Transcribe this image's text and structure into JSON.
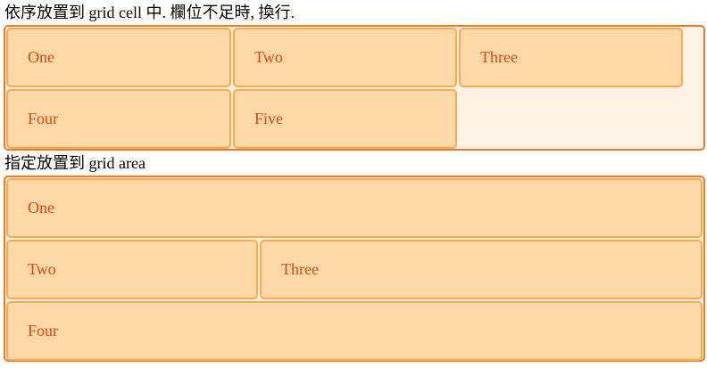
{
  "section1": {
    "heading": "依序放置到 grid cell 中. 欄位不足時, 換行.",
    "items": [
      {
        "label": "One"
      },
      {
        "label": "Two"
      },
      {
        "label": "Three"
      },
      {
        "label": "Four"
      },
      {
        "label": "Five"
      }
    ]
  },
  "section2": {
    "heading": "指定放置到 grid area",
    "items": [
      {
        "label": "One"
      },
      {
        "label": "Two"
      },
      {
        "label": "Three"
      },
      {
        "label": "Four"
      }
    ]
  },
  "colors": {
    "wrapper_border": "#ee7a22",
    "wrapper_background": "#fff2e3",
    "cell_border": "#ffa94f",
    "cell_background": "#ffd8a8",
    "cell_text": "#d9480f"
  }
}
